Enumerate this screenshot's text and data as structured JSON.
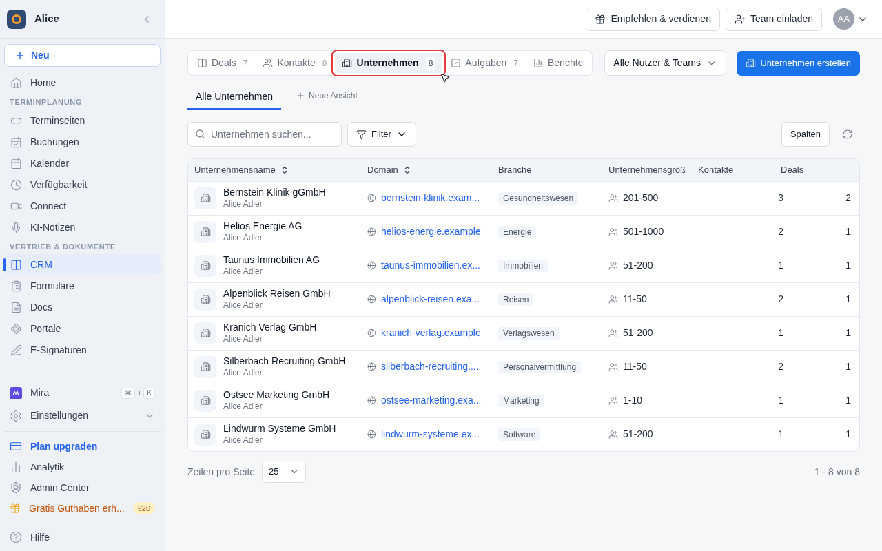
{
  "sidebar": {
    "workspace": "Alice",
    "new_button": "Neu",
    "nav": [
      {
        "kind": "item",
        "label": "Home",
        "selected": false
      },
      {
        "kind": "section",
        "label": "TERMINPLANUNG"
      },
      {
        "kind": "item",
        "label": "Terminseiten",
        "selected": false
      },
      {
        "kind": "item",
        "label": "Buchungen",
        "selected": false
      },
      {
        "kind": "item",
        "label": "Kalender",
        "selected": false
      },
      {
        "kind": "item",
        "label": "Verfügbarkeit",
        "selected": false
      },
      {
        "kind": "item",
        "label": "Connect",
        "selected": false
      },
      {
        "kind": "item",
        "label": "KI-Notizen",
        "selected": false
      },
      {
        "kind": "section",
        "label": "VERTRIEB & DOKUMENTE"
      },
      {
        "kind": "item",
        "label": "CRM",
        "selected": true
      },
      {
        "kind": "item",
        "label": "Formulare",
        "selected": false
      },
      {
        "kind": "item",
        "label": "Docs",
        "selected": false
      },
      {
        "kind": "item",
        "label": "Portale",
        "selected": false
      },
      {
        "kind": "item",
        "label": "E-Signaturen",
        "selected": false
      }
    ],
    "assistant": {
      "label": "Mira",
      "keys": [
        "⌘",
        "K"
      ],
      "joiner": "+"
    },
    "settings": {
      "label": "Einstellungen",
      "expanded": false
    },
    "bottom": [
      {
        "label": "Plan upgraden",
        "kind": "upgrade"
      },
      {
        "label": "Analytik",
        "kind": "plain"
      },
      {
        "label": "Admin Center",
        "kind": "plain"
      },
      {
        "label": "Gratis Guthaben erh...",
        "kind": "promo",
        "badge": "€20"
      }
    ],
    "help": "Hilfe"
  },
  "header": {
    "refer": "Empfehlen & verdienen",
    "invite": "Team einladen",
    "avatar": "AA"
  },
  "tabs": [
    {
      "label": "Deals",
      "count": "7",
      "selected": false,
      "highlighted": false
    },
    {
      "label": "Kontakte",
      "count": "8",
      "selected": false,
      "highlighted": false
    },
    {
      "label": "Unternehmen",
      "count": "8",
      "selected": true,
      "highlighted": true
    },
    {
      "label": "Aufgaben",
      "count": "7",
      "selected": false,
      "highlighted": false
    },
    {
      "label": "Berichte",
      "selected": false,
      "highlighted": false
    }
  ],
  "owner_filter": "Alle Nutzer & Teams",
  "create_button": "Unternehmen erstellen",
  "views": [
    {
      "label": "Alle Unternehmen",
      "selected": true
    }
  ],
  "new_view": "Neue Ansicht",
  "search": {
    "placeholder": "Unternehmen suchen..."
  },
  "filter": "Filter",
  "columns_button": "Spalten",
  "table": {
    "columns": [
      {
        "label": "Unternehmensname",
        "sortable": true
      },
      {
        "label": "Domain",
        "sortable": true
      },
      {
        "label": "Branche",
        "sortable": false
      },
      {
        "label": "Unternehmensgröß",
        "sortable": false
      },
      {
        "label": "Kontakte",
        "sortable": false
      },
      {
        "label": "Deals",
        "sortable": false
      }
    ],
    "rows": [
      {
        "name": "Bernstein Klinik gGmbH",
        "owner": "Alice Adler",
        "domain": "bernstein-klinik.exam...",
        "industry": "Gesundheitswesen",
        "size": "201-500",
        "contacts": "3",
        "deals": "2"
      },
      {
        "name": "Helios Energie AG",
        "owner": "Alice Adler",
        "domain": "helios-energie.example",
        "industry": "Energie",
        "size": "501-1000",
        "contacts": "2",
        "deals": "1"
      },
      {
        "name": "Taunus Immobilien AG",
        "owner": "Alice Adler",
        "domain": "taunus-immobilien.ex...",
        "industry": "Immobilien",
        "size": "51-200",
        "contacts": "1",
        "deals": "1"
      },
      {
        "name": "Alpenblick Reisen GmbH",
        "owner": "Alice Adler",
        "domain": "alpenblick-reisen.exa...",
        "industry": "Reisen",
        "size": "11-50",
        "contacts": "2",
        "deals": "1"
      },
      {
        "name": "Kranich Verlag GmbH",
        "owner": "Alice Adler",
        "domain": "kranich-verlag.example",
        "industry": "Verlagswesen",
        "size": "51-200",
        "contacts": "1",
        "deals": "1"
      },
      {
        "name": "Silberbach Recruiting GmbH",
        "owner": "Alice Adler",
        "domain": "silberbach-recruiting....",
        "industry": "Personalvermittlung",
        "size": "11-50",
        "contacts": "2",
        "deals": "1"
      },
      {
        "name": "Ostsee Marketing GmbH",
        "owner": "Alice Adler",
        "domain": "ostsee-marketing.exa...",
        "industry": "Marketing",
        "size": "1-10",
        "contacts": "1",
        "deals": "1"
      },
      {
        "name": "Lindwurm Systeme GmbH",
        "owner": "Alice Adler",
        "domain": "lindwurm-systeme.ex...",
        "industry": "Software",
        "size": "51-200",
        "contacts": "1",
        "deals": "1"
      }
    ]
  },
  "pagination": {
    "rows_label": "Zeilen pro Seite",
    "page_size": "25",
    "range": "1 - 8 von 8"
  }
}
